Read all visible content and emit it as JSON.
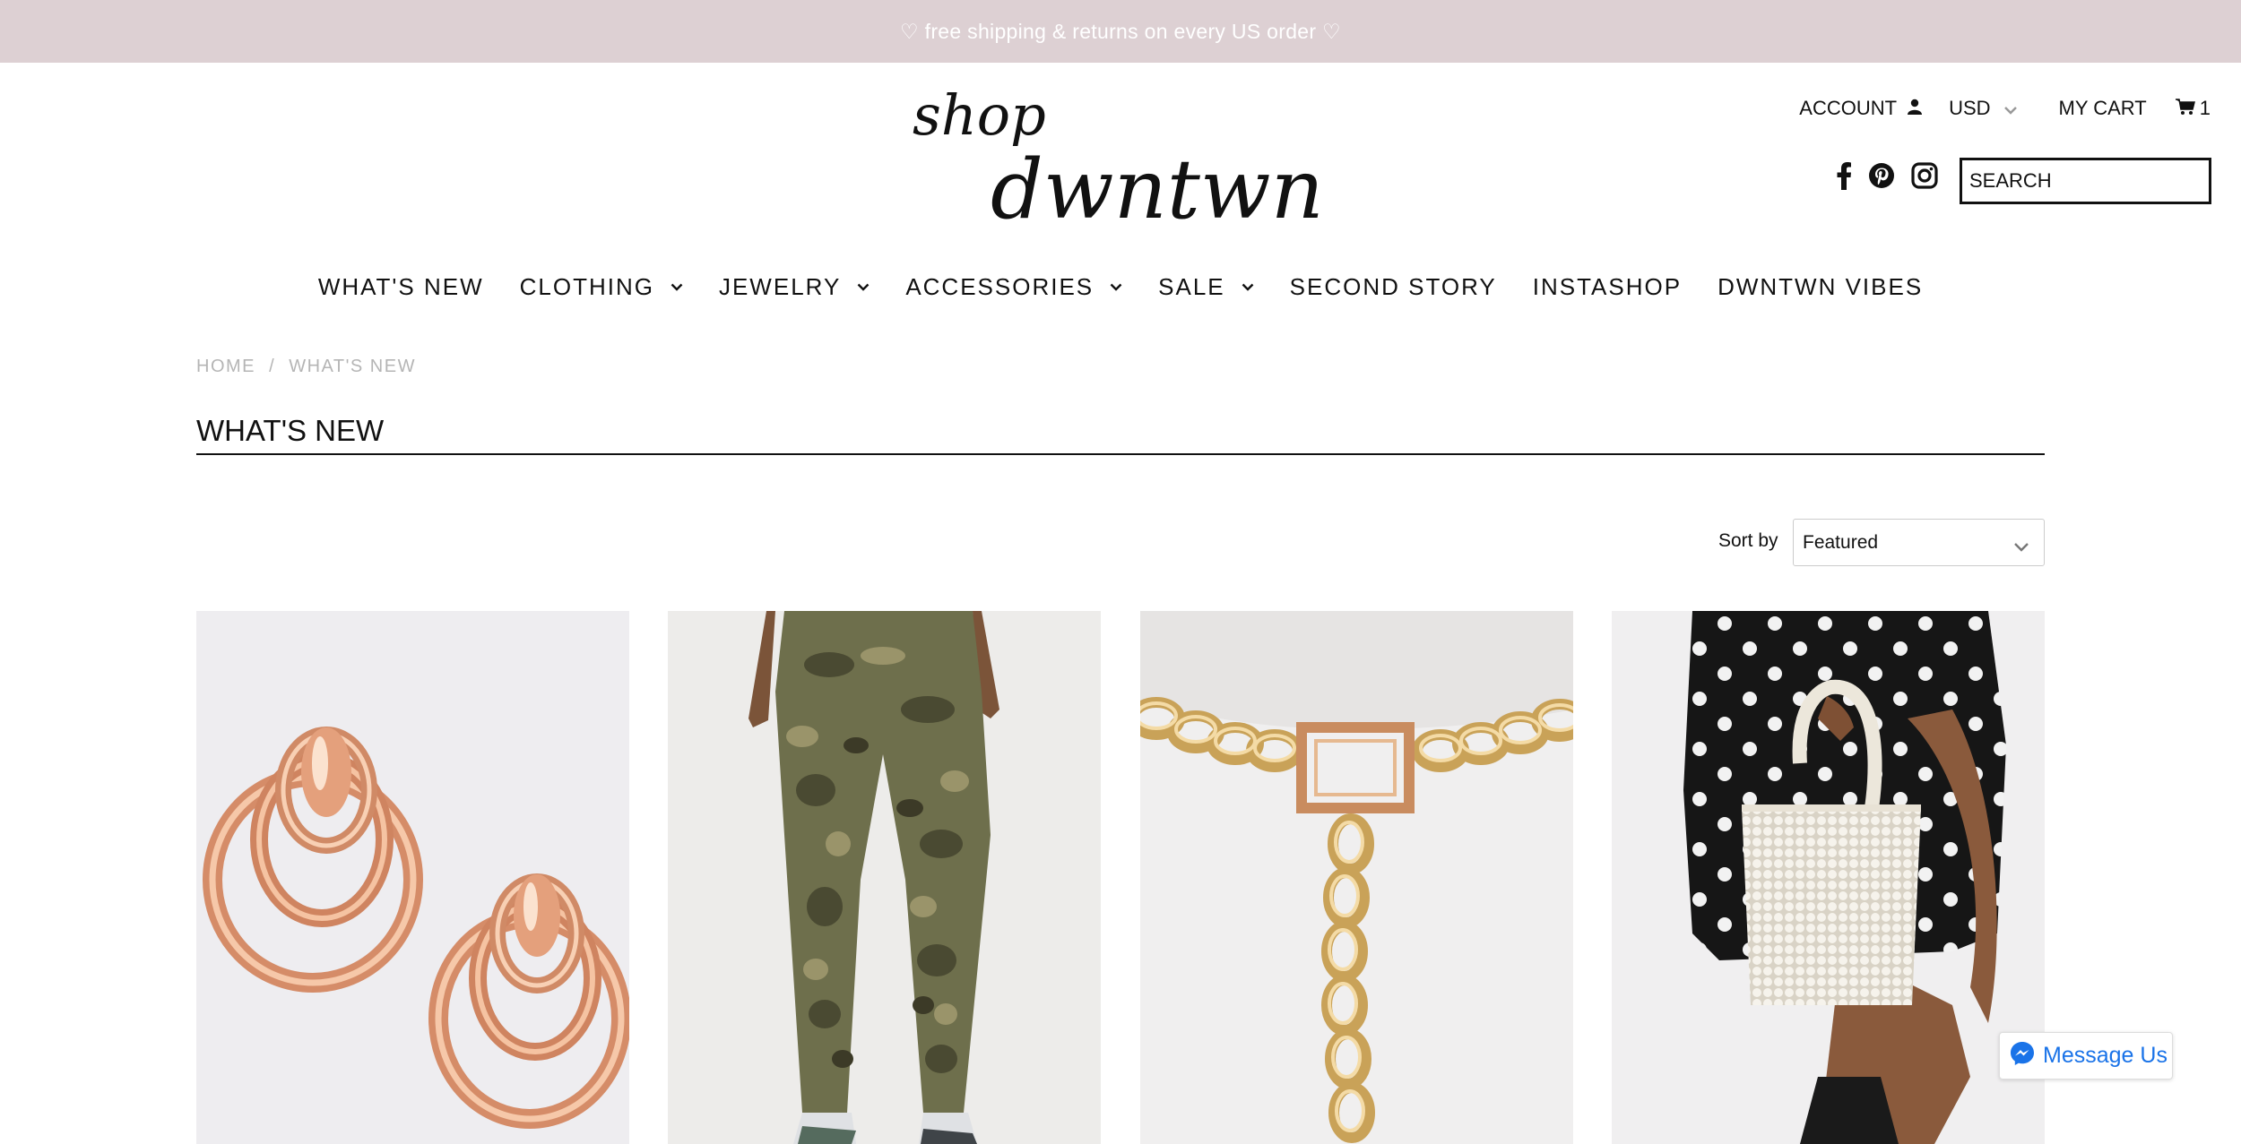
{
  "announcement": "♡ free shipping & returns on every US order ♡",
  "logo": {
    "line1": "shop",
    "line2": "dwntwn"
  },
  "header": {
    "account_label": "ACCOUNT",
    "currency": "USD",
    "cart_label": "MY CART",
    "cart_count": "1",
    "search_placeholder": "SEARCH"
  },
  "social": [
    "facebook-icon",
    "pinterest-icon",
    "instagram-icon"
  ],
  "nav": [
    {
      "label": "WHAT'S NEW",
      "dropdown": false
    },
    {
      "label": "CLOTHING",
      "dropdown": true
    },
    {
      "label": "JEWELRY",
      "dropdown": true
    },
    {
      "label": "ACCESSORIES",
      "dropdown": true
    },
    {
      "label": "SALE",
      "dropdown": true
    },
    {
      "label": "SECOND STORY",
      "dropdown": false
    },
    {
      "label": "INSTASHOP",
      "dropdown": false
    },
    {
      "label": "DWNTWN VIBES",
      "dropdown": false
    }
  ],
  "breadcrumb": {
    "home": "HOME",
    "separator": "/",
    "current": "WHAT'S NEW"
  },
  "page_title": "WHAT'S NEW",
  "sort": {
    "label": "Sort by",
    "selected": "Featured"
  },
  "products": [
    {
      "image": "rose-gold-hoop-earrings"
    },
    {
      "image": "camo-cargo-jogger-pants"
    },
    {
      "image": "gold-chain-belt"
    },
    {
      "image": "pearl-beaded-handbag"
    }
  ],
  "messenger": {
    "label": "Message Us"
  },
  "colors": {
    "announcement_bg": "#ddd0d3",
    "messenger_blue": "#1a73e8"
  }
}
